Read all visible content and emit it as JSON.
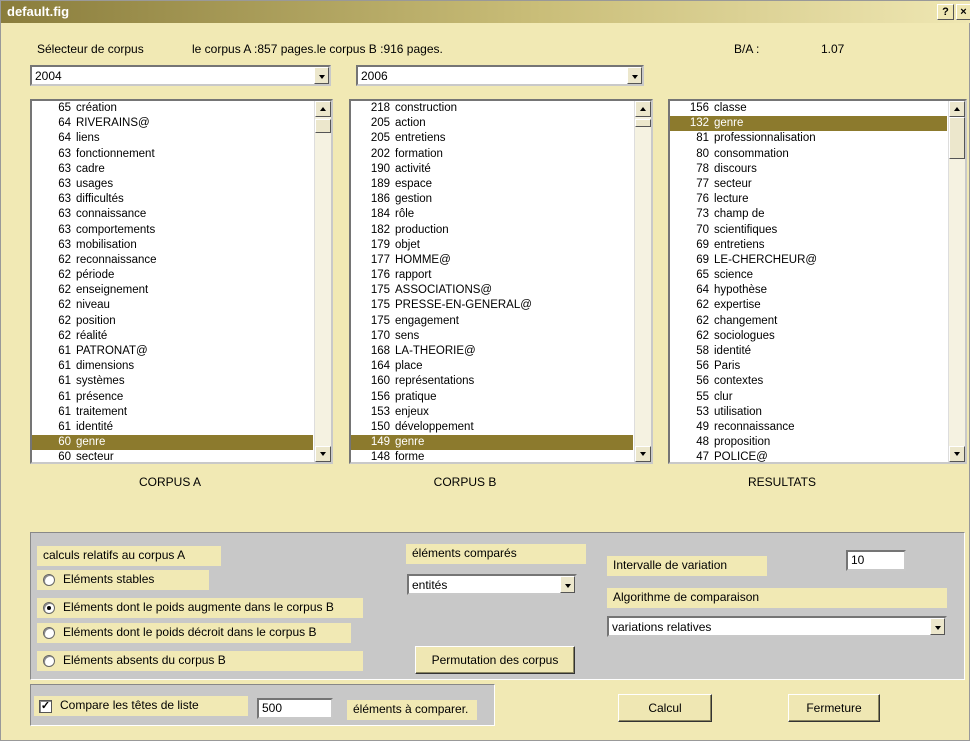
{
  "window": {
    "title": "default.fig",
    "help_label": "?",
    "close_label": "×"
  },
  "header": {
    "selector_label": "Sélecteur de corpus",
    "corpus_info": "le corpus A :857 pages.le corpus B :916 pages.",
    "ratio_label": "B/A :",
    "ratio_value": "1.07"
  },
  "combos": {
    "corpus_a_year": "2004",
    "corpus_b_year": "2006"
  },
  "corpus_a": {
    "caption": "CORPUS A",
    "items": [
      {
        "n": "65",
        "w": "création"
      },
      {
        "n": "64",
        "w": "RIVERAINS@"
      },
      {
        "n": "64",
        "w": "liens"
      },
      {
        "n": "63",
        "w": "fonctionnement"
      },
      {
        "n": "63",
        "w": "cadre"
      },
      {
        "n": "63",
        "w": "usages"
      },
      {
        "n": "63",
        "w": "difficultés"
      },
      {
        "n": "63",
        "w": "connaissance"
      },
      {
        "n": "63",
        "w": "comportements"
      },
      {
        "n": "63",
        "w": "mobilisation"
      },
      {
        "n": "62",
        "w": "reconnaissance"
      },
      {
        "n": "62",
        "w": "période"
      },
      {
        "n": "62",
        "w": "enseignement"
      },
      {
        "n": "62",
        "w": "niveau"
      },
      {
        "n": "62",
        "w": "position"
      },
      {
        "n": "62",
        "w": "réalité"
      },
      {
        "n": "61",
        "w": "PATRONAT@"
      },
      {
        "n": "61",
        "w": "dimensions"
      },
      {
        "n": "61",
        "w": "systèmes"
      },
      {
        "n": "61",
        "w": "présence"
      },
      {
        "n": "61",
        "w": "traitement"
      },
      {
        "n": "61",
        "w": "identité"
      },
      {
        "n": "60",
        "w": "genre",
        "selected": true
      },
      {
        "n": "60",
        "w": "secteur"
      }
    ]
  },
  "corpus_b": {
    "caption": "CORPUS B",
    "items": [
      {
        "n": "218",
        "w": "construction"
      },
      {
        "n": "205",
        "w": "action"
      },
      {
        "n": "205",
        "w": "entretiens"
      },
      {
        "n": "202",
        "w": "formation"
      },
      {
        "n": "190",
        "w": "activité"
      },
      {
        "n": "189",
        "w": "espace"
      },
      {
        "n": "186",
        "w": "gestion"
      },
      {
        "n": "184",
        "w": "rôle"
      },
      {
        "n": "182",
        "w": "production"
      },
      {
        "n": "179",
        "w": "objet"
      },
      {
        "n": "177",
        "w": "HOMME@"
      },
      {
        "n": "176",
        "w": "rapport"
      },
      {
        "n": "175",
        "w": "ASSOCIATIONS@"
      },
      {
        "n": "175",
        "w": "PRESSE-EN-GENERAL@"
      },
      {
        "n": "175",
        "w": "engagement"
      },
      {
        "n": "170",
        "w": "sens"
      },
      {
        "n": "168",
        "w": "LA-THEORIE@"
      },
      {
        "n": "164",
        "w": "place"
      },
      {
        "n": "160",
        "w": "représentations"
      },
      {
        "n": "156",
        "w": "pratique"
      },
      {
        "n": "153",
        "w": "enjeux"
      },
      {
        "n": "150",
        "w": "développement"
      },
      {
        "n": "149",
        "w": "genre",
        "selected": true
      },
      {
        "n": "148",
        "w": "forme"
      }
    ]
  },
  "resultats": {
    "caption": "RESULTATS",
    "items": [
      {
        "n": "156",
        "w": "classe"
      },
      {
        "n": "132",
        "w": "genre",
        "selected": true
      },
      {
        "n": "81",
        "w": "professionnalisation"
      },
      {
        "n": "80",
        "w": "consommation"
      },
      {
        "n": "78",
        "w": "discours"
      },
      {
        "n": "77",
        "w": "secteur"
      },
      {
        "n": "76",
        "w": "lecture"
      },
      {
        "n": "73",
        "w": "champ de"
      },
      {
        "n": "70",
        "w": "scientifiques"
      },
      {
        "n": "69",
        "w": "entretiens"
      },
      {
        "n": "69",
        "w": "LE-CHERCHEUR@"
      },
      {
        "n": "65",
        "w": "science"
      },
      {
        "n": "64",
        "w": "hypothèse"
      },
      {
        "n": "62",
        "w": "expertise"
      },
      {
        "n": "62",
        "w": "changement"
      },
      {
        "n": "62",
        "w": "sociologues"
      },
      {
        "n": "58",
        "w": "identité"
      },
      {
        "n": "56",
        "w": "Paris"
      },
      {
        "n": "56",
        "w": "contextes"
      },
      {
        "n": "55",
        "w": "clur"
      },
      {
        "n": "53",
        "w": "utilisation"
      },
      {
        "n": "49",
        "w": "reconnaissance"
      },
      {
        "n": "48",
        "w": "proposition"
      },
      {
        "n": "47",
        "w": "POLICE@"
      }
    ]
  },
  "options": {
    "calc_group_label": "calculs relatifs au corpus A",
    "radios": [
      {
        "label": "Eléments stables",
        "checked": false
      },
      {
        "label": "Eléments dont le poids augmente dans le corpus B",
        "checked": true
      },
      {
        "label": "Eléments dont le poids décroit dans le corpus B",
        "checked": false
      },
      {
        "label": "Eléments absents du corpus B",
        "checked": false
      }
    ],
    "compared_label": "éléments comparés",
    "compared_value": "entités",
    "permutation_label": "Permutation des corpus",
    "interval_label": "Intervalle de variation",
    "interval_value": "10",
    "algo_label": "Algorithme de comparaison",
    "algo_value": "variations relatives"
  },
  "footer": {
    "compare_heads_label": "Compare les têtes de liste",
    "compare_heads_checked": true,
    "count_value": "500",
    "count_suffix": "éléments à comparer.",
    "calc_button": "Calcul",
    "close_button": "Fermeture"
  }
}
